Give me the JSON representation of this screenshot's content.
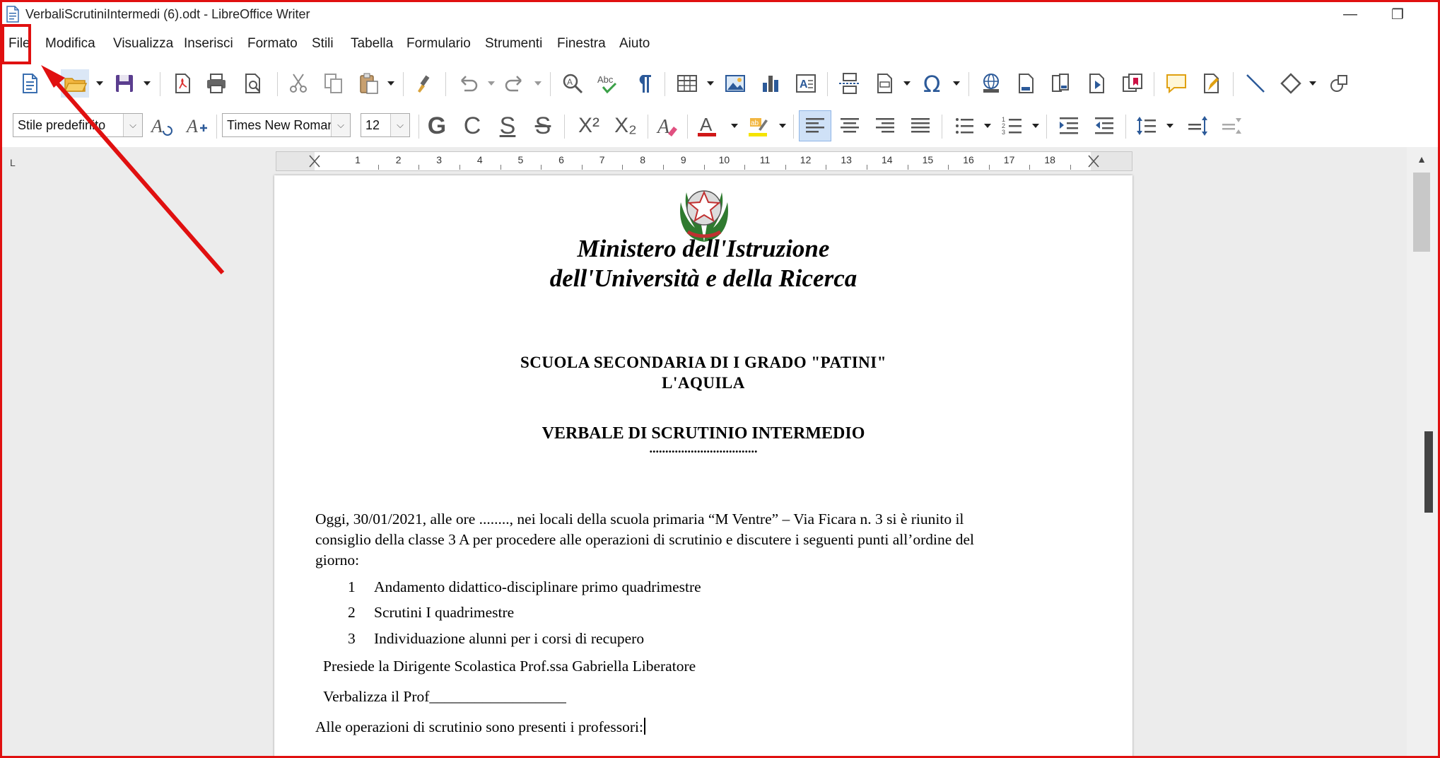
{
  "window": {
    "title": "VerbaliScrutiniIntermedi (6).odt - LibreOffice Writer",
    "minimize_glyph": "—",
    "restore_glyph": "❐"
  },
  "menu": {
    "items": [
      "File",
      "Modifica",
      "Visualizza",
      "Inserisci",
      "Formato",
      "Stili",
      "Tabella",
      "Formulario",
      "Strumenti",
      "Finestra",
      "Aiuto"
    ]
  },
  "toolbar2": {
    "paragraph_style": "Stile predefinito",
    "font_name": "Times New Roman",
    "font_size": "12",
    "bold_glyph": "G",
    "italic_glyph": "C",
    "underline_glyph": "S",
    "strike_glyph": "S",
    "superscript_glyph": "X²",
    "subscript_glyph": "X₂"
  },
  "ruler": {
    "corner": "L",
    "numbers": [
      "1",
      "2",
      "3",
      "4",
      "5",
      "6",
      "7",
      "8",
      "9",
      "10",
      "11",
      "12",
      "13",
      "14",
      "15",
      "16",
      "17",
      "18"
    ]
  },
  "document": {
    "ministry_line1": "Ministero dell'Istruzione",
    "ministry_line2": "dell'Università e della Ricerca",
    "school_line1": "SCUOLA SECONDARIA DI I GRADO \"PATINI\"",
    "school_line2": "L'AQUILA",
    "verbale_title": "VERBALE DI SCRUTINIO INTERMEDIO",
    "verbale_dots": "..................................",
    "intro_line1": "Oggi, 30/01/2021, alle ore ........, nei locali della scuola primaria “M Ventre” – Via Ficara n. 3  si è riunito il",
    "intro_line2": "consiglio della classe 3 A  per procedere alle operazioni di scrutinio e discutere i seguenti punti all’ordine del",
    "intro_line3": "giorno:",
    "agenda": [
      {
        "num": "1",
        "text": "Andamento didattico-disciplinare primo quadrimestre"
      },
      {
        "num": "2",
        "text": "Scrutini I quadrimestre"
      },
      {
        "num": "3",
        "text": "Individuazione alunni per i corsi di recupero"
      }
    ],
    "presiede": "Presiede la Dirigente Scolastica Prof.ssa Gabriella Liberatore",
    "verbalizza": "Verbalizza il Prof__________________",
    "presenti": "Alle operazioni di scrutinio sono presenti i professori:"
  },
  "colors": {
    "annotation_red": "#e01010",
    "menu_text": "#1a1a1a",
    "active_align_bg": "#cfe1f7",
    "document_bg": "#ececec"
  }
}
